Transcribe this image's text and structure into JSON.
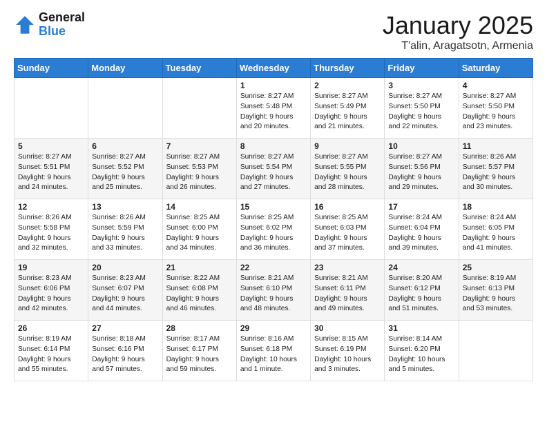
{
  "logo": {
    "line1": "General",
    "line2": "Blue"
  },
  "header": {
    "month": "January 2025",
    "location": "T'alin, Aragatsotn, Armenia"
  },
  "weekdays": [
    "Sunday",
    "Monday",
    "Tuesday",
    "Wednesday",
    "Thursday",
    "Friday",
    "Saturday"
  ],
  "weeks": [
    [
      {
        "day": "",
        "info": ""
      },
      {
        "day": "",
        "info": ""
      },
      {
        "day": "",
        "info": ""
      },
      {
        "day": "1",
        "info": "Sunrise: 8:27 AM\nSunset: 5:48 PM\nDaylight: 9 hours\nand 20 minutes."
      },
      {
        "day": "2",
        "info": "Sunrise: 8:27 AM\nSunset: 5:49 PM\nDaylight: 9 hours\nand 21 minutes."
      },
      {
        "day": "3",
        "info": "Sunrise: 8:27 AM\nSunset: 5:50 PM\nDaylight: 9 hours\nand 22 minutes."
      },
      {
        "day": "4",
        "info": "Sunrise: 8:27 AM\nSunset: 5:50 PM\nDaylight: 9 hours\nand 23 minutes."
      }
    ],
    [
      {
        "day": "5",
        "info": "Sunrise: 8:27 AM\nSunset: 5:51 PM\nDaylight: 9 hours\nand 24 minutes."
      },
      {
        "day": "6",
        "info": "Sunrise: 8:27 AM\nSunset: 5:52 PM\nDaylight: 9 hours\nand 25 minutes."
      },
      {
        "day": "7",
        "info": "Sunrise: 8:27 AM\nSunset: 5:53 PM\nDaylight: 9 hours\nand 26 minutes."
      },
      {
        "day": "8",
        "info": "Sunrise: 8:27 AM\nSunset: 5:54 PM\nDaylight: 9 hours\nand 27 minutes."
      },
      {
        "day": "9",
        "info": "Sunrise: 8:27 AM\nSunset: 5:55 PM\nDaylight: 9 hours\nand 28 minutes."
      },
      {
        "day": "10",
        "info": "Sunrise: 8:27 AM\nSunset: 5:56 PM\nDaylight: 9 hours\nand 29 minutes."
      },
      {
        "day": "11",
        "info": "Sunrise: 8:26 AM\nSunset: 5:57 PM\nDaylight: 9 hours\nand 30 minutes."
      }
    ],
    [
      {
        "day": "12",
        "info": "Sunrise: 8:26 AM\nSunset: 5:58 PM\nDaylight: 9 hours\nand 32 minutes."
      },
      {
        "day": "13",
        "info": "Sunrise: 8:26 AM\nSunset: 5:59 PM\nDaylight: 9 hours\nand 33 minutes."
      },
      {
        "day": "14",
        "info": "Sunrise: 8:25 AM\nSunset: 6:00 PM\nDaylight: 9 hours\nand 34 minutes."
      },
      {
        "day": "15",
        "info": "Sunrise: 8:25 AM\nSunset: 6:02 PM\nDaylight: 9 hours\nand 36 minutes."
      },
      {
        "day": "16",
        "info": "Sunrise: 8:25 AM\nSunset: 6:03 PM\nDaylight: 9 hours\nand 37 minutes."
      },
      {
        "day": "17",
        "info": "Sunrise: 8:24 AM\nSunset: 6:04 PM\nDaylight: 9 hours\nand 39 minutes."
      },
      {
        "day": "18",
        "info": "Sunrise: 8:24 AM\nSunset: 6:05 PM\nDaylight: 9 hours\nand 41 minutes."
      }
    ],
    [
      {
        "day": "19",
        "info": "Sunrise: 8:23 AM\nSunset: 6:06 PM\nDaylight: 9 hours\nand 42 minutes."
      },
      {
        "day": "20",
        "info": "Sunrise: 8:23 AM\nSunset: 6:07 PM\nDaylight: 9 hours\nand 44 minutes."
      },
      {
        "day": "21",
        "info": "Sunrise: 8:22 AM\nSunset: 6:08 PM\nDaylight: 9 hours\nand 46 minutes."
      },
      {
        "day": "22",
        "info": "Sunrise: 8:21 AM\nSunset: 6:10 PM\nDaylight: 9 hours\nand 48 minutes."
      },
      {
        "day": "23",
        "info": "Sunrise: 8:21 AM\nSunset: 6:11 PM\nDaylight: 9 hours\nand 49 minutes."
      },
      {
        "day": "24",
        "info": "Sunrise: 8:20 AM\nSunset: 6:12 PM\nDaylight: 9 hours\nand 51 minutes."
      },
      {
        "day": "25",
        "info": "Sunrise: 8:19 AM\nSunset: 6:13 PM\nDaylight: 9 hours\nand 53 minutes."
      }
    ],
    [
      {
        "day": "26",
        "info": "Sunrise: 8:19 AM\nSunset: 6:14 PM\nDaylight: 9 hours\nand 55 minutes."
      },
      {
        "day": "27",
        "info": "Sunrise: 8:18 AM\nSunset: 6:16 PM\nDaylight: 9 hours\nand 57 minutes."
      },
      {
        "day": "28",
        "info": "Sunrise: 8:17 AM\nSunset: 6:17 PM\nDaylight: 9 hours\nand 59 minutes."
      },
      {
        "day": "29",
        "info": "Sunrise: 8:16 AM\nSunset: 6:18 PM\nDaylight: 10 hours\nand 1 minute."
      },
      {
        "day": "30",
        "info": "Sunrise: 8:15 AM\nSunset: 6:19 PM\nDaylight: 10 hours\nand 3 minutes."
      },
      {
        "day": "31",
        "info": "Sunrise: 8:14 AM\nSunset: 6:20 PM\nDaylight: 10 hours\nand 5 minutes."
      },
      {
        "day": "",
        "info": ""
      }
    ]
  ]
}
